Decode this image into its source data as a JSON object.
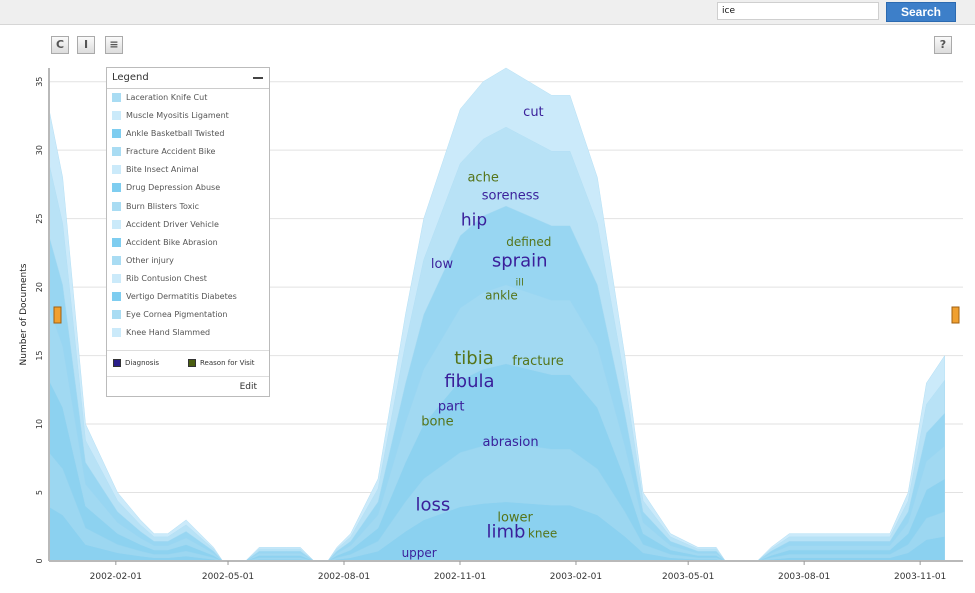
{
  "search": {
    "value": "ice",
    "button_label": "Search"
  },
  "toolbar": {
    "refresh_glyph": "C",
    "text_glyph": "I",
    "comment_glyph": "≡",
    "help_label": "?"
  },
  "legend": {
    "title": "Legend",
    "items": [
      {
        "label": "Laceration Knife Cut",
        "color": "#a9dcf3"
      },
      {
        "label": "Muscle Myositis Ligament",
        "color": "#cbeafa"
      },
      {
        "label": "Ankle Basketball Twisted",
        "color": "#7ecdf0"
      },
      {
        "label": "Fracture Accident Bike",
        "color": "#a9dcf3"
      },
      {
        "label": "Bite Insect Animal",
        "color": "#cbeafa"
      },
      {
        "label": "Drug Depression Abuse",
        "color": "#7ecdf0"
      },
      {
        "label": "Burn Blisters Toxic",
        "color": "#a9dcf3"
      },
      {
        "label": "Accident Driver Vehicle",
        "color": "#cbeafa"
      },
      {
        "label": "Accident Bike Abrasion",
        "color": "#7ecdf0"
      },
      {
        "label": "Other injury",
        "color": "#a9dcf3"
      },
      {
        "label": "Rib Contusion Chest",
        "color": "#cbeafa"
      },
      {
        "label": "Vertigo Dermatitis Diabetes",
        "color": "#7ecdf0"
      },
      {
        "label": "Eye Cornea Pigmentation",
        "color": "#a9dcf3"
      },
      {
        "label": "Knee Hand Slammed",
        "color": "#cbeafa"
      }
    ],
    "keys": [
      {
        "label": "Diagnosis",
        "color": "#2b1f8a"
      },
      {
        "label": "Reason for Visit",
        "color": "#4a5e10"
      }
    ],
    "edit_label": "Edit"
  },
  "chart_data": {
    "type": "area",
    "stacked": true,
    "ylabel": "Number of Documents",
    "ylim": [
      0,
      36
    ],
    "yticks": [
      0,
      5,
      10,
      15,
      20,
      25,
      30,
      35
    ],
    "x_range": [
      "2001-12-10",
      "2003-12-05"
    ],
    "x_ticks": [
      "2002-02-01",
      "2002-05-01",
      "2002-08-01",
      "2002-11-01",
      "2003-02-01",
      "2003-05-01",
      "2003-08-01",
      "2003-11-01"
    ],
    "grid": true,
    "colors": {
      "light": "#cbeafa",
      "mid": "#a9dcf3",
      "dark": "#7ecdf0",
      "text_diagnosis": "#3a1f9a",
      "text_reason": "#55741a"
    },
    "series_total": [
      [
        0,
        33
      ],
      [
        0.03,
        28
      ],
      [
        0.08,
        10
      ],
      [
        0.15,
        5
      ],
      [
        0.2,
        3
      ],
      [
        0.23,
        2
      ],
      [
        0.26,
        2
      ],
      [
        0.3,
        3
      ],
      [
        0.33,
        2
      ],
      [
        0.36,
        1
      ],
      [
        0.38,
        0
      ],
      [
        0.43,
        0
      ],
      [
        0.46,
        1
      ],
      [
        0.49,
        1
      ],
      [
        0.52,
        1
      ],
      [
        0.55,
        1
      ],
      [
        0.58,
        0
      ],
      [
        0.61,
        0
      ],
      [
        0.63,
        1
      ],
      [
        0.66,
        2
      ],
      [
        0.69,
        4
      ],
      [
        0.72,
        6
      ],
      [
        0.74,
        10
      ],
      [
        0.78,
        18
      ],
      [
        0.82,
        25
      ],
      [
        0.86,
        29
      ],
      [
        0.9,
        33
      ],
      [
        0.95,
        35
      ],
      [
        1.0,
        36
      ],
      [
        1.05,
        35
      ],
      [
        1.1,
        34
      ],
      [
        1.14,
        34
      ],
      [
        1.2,
        28
      ],
      [
        1.26,
        15
      ],
      [
        1.3,
        5
      ],
      [
        1.36,
        2
      ],
      [
        1.42,
        1
      ],
      [
        1.46,
        1
      ],
      [
        1.48,
        0
      ],
      [
        1.55,
        0
      ],
      [
        1.58,
        1
      ],
      [
        1.62,
        2
      ],
      [
        1.7,
        2
      ],
      [
        1.78,
        2
      ],
      [
        1.82,
        2
      ],
      [
        1.84,
        2
      ],
      [
        1.88,
        5
      ],
      [
        1.92,
        13
      ],
      [
        1.96,
        15
      ]
    ],
    "series_layers": [
      {
        "name": "band1",
        "scale": 0.88
      },
      {
        "name": "band2",
        "scale": 0.72
      },
      {
        "name": "band3",
        "scale": 0.56
      },
      {
        "name": "band4",
        "scale": 0.4
      },
      {
        "name": "band5",
        "scale": 0.24
      },
      {
        "name": "band6",
        "scale": 0.12
      }
    ],
    "terms": [
      {
        "text": "cut",
        "kind": "diagnosis",
        "x": 1.06,
        "y": 32.5,
        "size": 13
      },
      {
        "text": "ache",
        "kind": "reason",
        "x": 0.95,
        "y": 27.7,
        "size": 13
      },
      {
        "text": "soreness",
        "kind": "diagnosis",
        "x": 1.01,
        "y": 26.4,
        "size": 13
      },
      {
        "text": "hip",
        "kind": "diagnosis",
        "x": 0.93,
        "y": 24.5,
        "size": 17
      },
      {
        "text": "defined",
        "kind": "reason",
        "x": 1.05,
        "y": 23.0,
        "size": 12
      },
      {
        "text": "low",
        "kind": "diagnosis",
        "x": 0.86,
        "y": 21.4,
        "size": 13
      },
      {
        "text": "sprain",
        "kind": "diagnosis",
        "x": 1.03,
        "y": 21.5,
        "size": 18
      },
      {
        "text": "ill",
        "kind": "reason",
        "x": 1.03,
        "y": 20.1,
        "size": 10
      },
      {
        "text": "ankle",
        "kind": "reason",
        "x": 0.99,
        "y": 19.1,
        "size": 12
      },
      {
        "text": "tibia",
        "kind": "reason",
        "x": 0.93,
        "y": 14.4,
        "size": 18
      },
      {
        "text": "fracture",
        "kind": "reason",
        "x": 1.07,
        "y": 14.3,
        "size": 13
      },
      {
        "text": "fibula",
        "kind": "diagnosis",
        "x": 0.92,
        "y": 12.7,
        "size": 18
      },
      {
        "text": "part",
        "kind": "diagnosis",
        "x": 0.88,
        "y": 11.0,
        "size": 13
      },
      {
        "text": "bone",
        "kind": "reason",
        "x": 0.85,
        "y": 9.9,
        "size": 13
      },
      {
        "text": "abrasion",
        "kind": "diagnosis",
        "x": 1.01,
        "y": 8.4,
        "size": 13
      },
      {
        "text": "loss",
        "kind": "diagnosis",
        "x": 0.84,
        "y": 3.7,
        "size": 18
      },
      {
        "text": "lower",
        "kind": "reason",
        "x": 1.02,
        "y": 2.9,
        "size": 13
      },
      {
        "text": "limb",
        "kind": "diagnosis",
        "x": 1.0,
        "y": 1.7,
        "size": 18
      },
      {
        "text": "knee",
        "kind": "reason",
        "x": 1.08,
        "y": 1.7,
        "size": 12
      },
      {
        "text": "upper",
        "kind": "diagnosis",
        "x": 0.81,
        "y": 0.3,
        "size": 12
      }
    ]
  }
}
